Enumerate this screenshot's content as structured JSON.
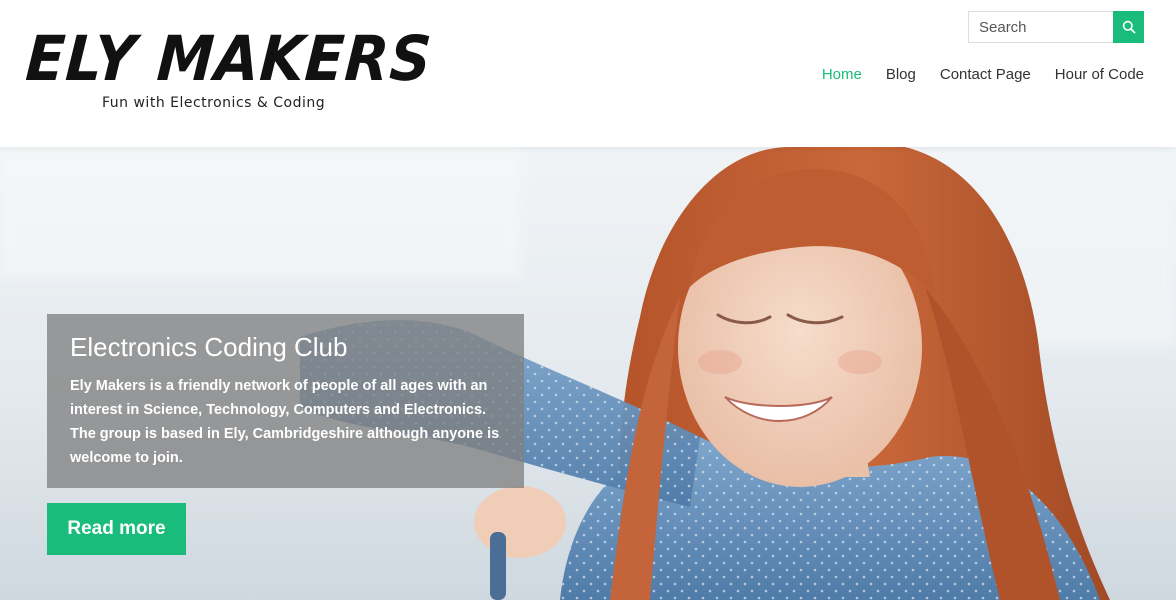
{
  "header": {
    "logo_title": "ELY MAKERS",
    "logo_tagline": "Fun with Electronics & Coding",
    "search": {
      "placeholder": "Search",
      "icon": "search-icon"
    },
    "nav": [
      {
        "label": "Home",
        "active": true
      },
      {
        "label": "Blog",
        "active": false
      },
      {
        "label": "Contact Page",
        "active": false
      },
      {
        "label": "Hour of Code",
        "active": false
      }
    ]
  },
  "hero": {
    "title": "Electronics Coding Club",
    "text": "Ely Makers is a friendly network of people of all ages with an interest in Science, Technology, Computers and Electronics. The group is based in Ely, Cambridgeshire although anyone is welcome to join.",
    "button_label": "Read more"
  },
  "colors": {
    "accent": "#1abc7b",
    "nav_text": "#333333",
    "caption_bg": "#808080"
  }
}
